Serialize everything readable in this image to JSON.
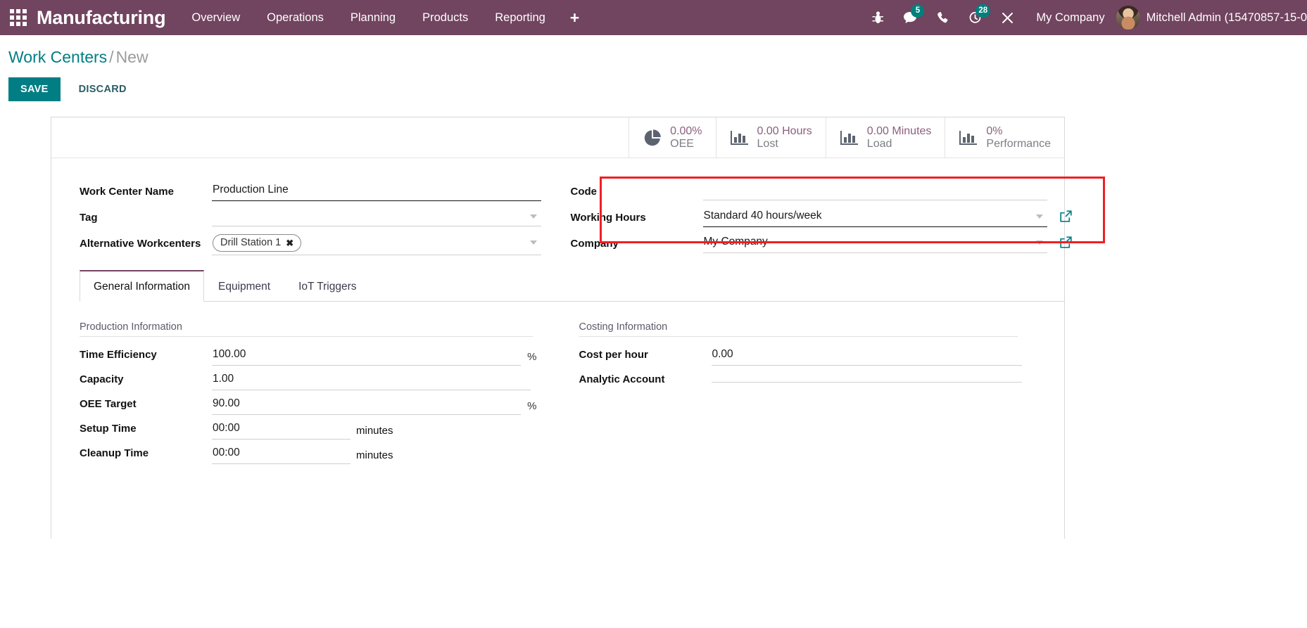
{
  "navbar": {
    "apps_icon": "apps-grid-icon",
    "brand": "Manufacturing",
    "menu": [
      {
        "label": "Overview"
      },
      {
        "label": "Operations"
      },
      {
        "label": "Planning"
      },
      {
        "label": "Products"
      },
      {
        "label": "Reporting"
      },
      {
        "label": "+"
      }
    ],
    "icons": [
      {
        "name": "bug-icon",
        "badge": null
      },
      {
        "name": "messages-icon",
        "badge": "5"
      },
      {
        "name": "phone-icon",
        "badge": null
      },
      {
        "name": "activities-clock-icon",
        "badge": "28"
      },
      {
        "name": "tools-wrench-icon",
        "badge": null
      }
    ],
    "company": "My Company",
    "user": "Mitchell Admin (15470857-15-0",
    "bg_color": "#71445f",
    "badge_color": "#00807b"
  },
  "control_panel": {
    "breadcrumb_root": "Work Centers",
    "breadcrumb_sep": "/",
    "breadcrumb_current": "New",
    "save_label": "SAVE",
    "discard_label": "DISCARD",
    "save_color": "#017e84"
  },
  "stats": [
    {
      "icon": "pie-chart-icon",
      "value": "0.00%",
      "label": "OEE"
    },
    {
      "icon": "bar-chart-icon",
      "value": "0.00 Hours",
      "label": "Lost"
    },
    {
      "icon": "bar-chart-icon",
      "value": "0.00 Minutes",
      "label": "Load"
    },
    {
      "icon": "bar-chart-icon",
      "value": "0%",
      "label": "Performance"
    }
  ],
  "form": {
    "left": {
      "work_center_name_label": "Work Center Name",
      "work_center_name_value": "Production Line",
      "tag_label": "Tag",
      "tag_value": "",
      "alternative_label": "Alternative Workcenters",
      "alternative_tag": "Drill Station 1",
      "alternative_tag_close": "✖"
    },
    "right": {
      "code_label": "Code",
      "code_value": "",
      "working_hours_label": "Working Hours",
      "working_hours_value": "Standard 40 hours/week",
      "company_label": "Company",
      "company_value": "My Company"
    },
    "highlight_color": "#ee1f25"
  },
  "notebook": {
    "tabs": [
      {
        "label": "General Information",
        "active": true
      },
      {
        "label": "Equipment",
        "active": false
      },
      {
        "label": "IoT Triggers",
        "active": false
      }
    ],
    "production": {
      "group_title": "Production Information",
      "rows": [
        {
          "label": "Time Efficiency",
          "value": "100.00",
          "unit": "%"
        },
        {
          "label": "Capacity",
          "value": "1.00",
          "unit": ""
        },
        {
          "label": "OEE Target",
          "value": "90.00",
          "unit": "%"
        },
        {
          "label": "Setup Time",
          "value": "00:00",
          "unit": "minutes"
        },
        {
          "label": "Cleanup Time",
          "value": "00:00",
          "unit": "minutes"
        }
      ]
    },
    "costing": {
      "group_title": "Costing Information",
      "rows": [
        {
          "label": "Cost per hour",
          "value": "0.00",
          "unit": ""
        },
        {
          "label": "Analytic Account",
          "value": "",
          "unit": ""
        }
      ]
    }
  }
}
